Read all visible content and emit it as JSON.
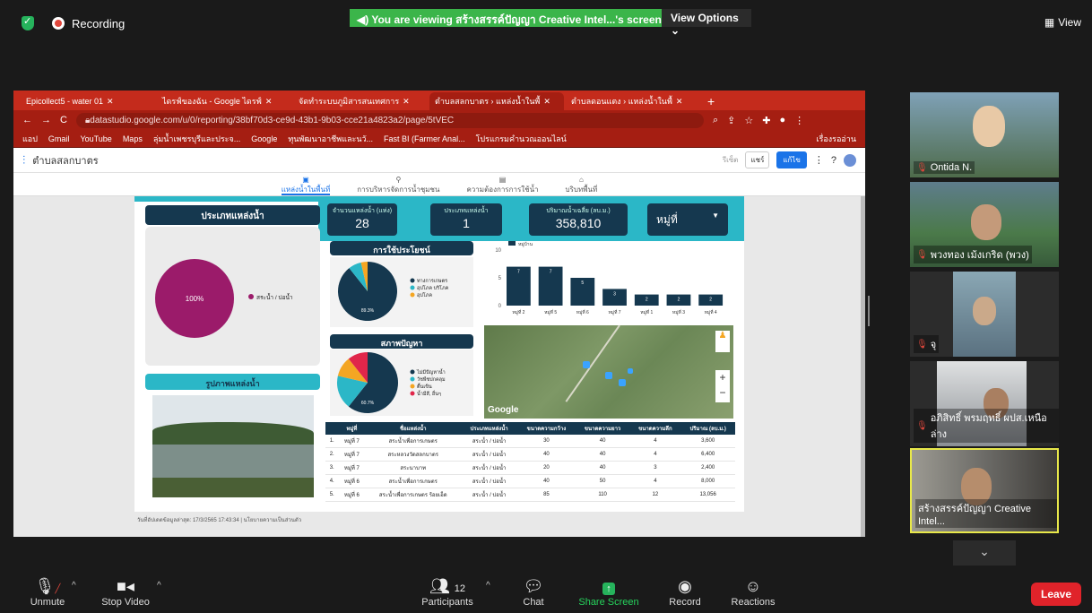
{
  "zoom": {
    "recording_label": "Recording",
    "banner": "You are viewing สร้างสรรค์ปัญญา Creative Intel...'s screen",
    "view_options": "View Options",
    "view_button": "View",
    "toolbar": {
      "unmute": "Unmute",
      "stop_video": "Stop Video",
      "participants": "Participants",
      "participants_count": "12",
      "chat": "Chat",
      "share_screen": "Share Screen",
      "record": "Record",
      "reactions": "Reactions",
      "leave": "Leave"
    },
    "participants": [
      {
        "name": "Ontida N.",
        "muted": true
      },
      {
        "name": "พวงทอง เม้งเกริด (พวง)",
        "muted": true
      },
      {
        "name": "จุ",
        "muted": true
      },
      {
        "name": "อภิสิทธิ์ พรมฤทธิ์ ผปส.เหนือล่าง",
        "muted": true
      },
      {
        "name": "สร้างสรรค์ปัญญา Creative Intel...",
        "muted": false
      }
    ]
  },
  "browser": {
    "tabs": [
      {
        "label": "Epicollect5 - water 01",
        "active": false
      },
      {
        "label": "ไดรฟ์ของฉัน - Google ไดรฟ์",
        "active": false
      },
      {
        "label": "จัดทำระบบภูมิสารสนเทศการ",
        "active": false
      },
      {
        "label": "ตำบลสลกบาตร › แหล่งน้ำในพื้",
        "active": true
      },
      {
        "label": "ตำบลดอนแตง › แหล่งน้ำในพื้",
        "active": false
      }
    ],
    "url": "datastudio.google.com/u/0/reporting/38bf70d3-ce9d-43b1-9b03-cce21a4823a2/page/5tVEC",
    "bookmarks": [
      "แอป",
      "Gmail",
      "YouTube",
      "Maps",
      "ลุ่มน้ำเพชรบุรีและประจ...",
      "Google",
      "ทุนพัฒนาอาชีพและนวั...",
      "Fast BI (Farmer Anal...",
      "โปรแกรมคำนวณออนไลน์"
    ],
    "reading_list": "เรื่องรออ่าน"
  },
  "report": {
    "title": "ตำบลสลกบาตร",
    "nav": [
      "แหล่งน้ำในพื้นที่",
      "การบริหารจัดการน้ำชุมชน",
      "ความต้องการการใช้น้ำ",
      "บริบทพื้นที่"
    ],
    "reset": "รีเซ็ต",
    "share": "แชร์",
    "edit": "แก้ไข",
    "water_type_header": "ประเภทแหล่งน้ำ",
    "water_type_pie": {
      "label": "สระน้ำ / บ่อน้ำ",
      "percent": "100%",
      "color": "#9b1b6a"
    },
    "kpis": [
      {
        "label": "จำนวนแหล่งน้ำ (แห่ง)",
        "value": "28"
      },
      {
        "label": "ประเภทแหล่งน้ำ",
        "value": "1"
      },
      {
        "label": "ปริมาณน้ำเฉลี่ย (ลบ.ม.)",
        "value": "358,810"
      }
    ],
    "village_select": "หมู่ที่",
    "usage_header": "การใช้ประโยชน์",
    "usage_legend": [
      "ทางการเกษตร",
      "อุปโภค บริโภค",
      "อุปโภค"
    ],
    "usage_percent": "89.3%",
    "problem_header": "สภาพปัญหา",
    "problem_legend": [
      "ไม่มีปัญหาน้ำ",
      "วัชพืชปกคลุม",
      "ตื้นเขิน",
      "น้ำมีสี, อื่นๆ"
    ],
    "problem_percent": "60.7%",
    "photo_header": "รูปภาพแหล่งน้ำ",
    "map_label": "Google",
    "footer": "วันที่อัปเดตข้อมูลล่าสุด: 17/3/2565 17:43:34 | นโยบายความเป็นส่วนตัว",
    "table_headers": [
      "",
      "หมู่ที่",
      "ชื่อแหล่งน้ำ",
      "ประเภทแหล่งน้ำ",
      "ขนาดความกว้าง",
      "ขนาดความยาว",
      "ขนาดความลึก",
      "ปริมาณ (ลบ.ม.)"
    ],
    "table_rows": [
      [
        "1.",
        "หมู่ที่ 7",
        "สระน้ำเพื่อการเกษตร",
        "สระน้ำ / บ่อน้ำ",
        "30",
        "40",
        "4",
        "3,600"
      ],
      [
        "2.",
        "หมู่ที่ 7",
        "สระหลวงวัดสลกบาตร",
        "สระน้ำ / บ่อน้ำ",
        "40",
        "40",
        "4",
        "6,400"
      ],
      [
        "3.",
        "หมู่ที่ 7",
        "สระนาบาท",
        "สระน้ำ / บ่อน้ำ",
        "20",
        "40",
        "3",
        "2,400"
      ],
      [
        "4.",
        "หมู่ที่ 6",
        "สระน้ำเพื่อการเกษตร",
        "สระน้ำ / บ่อน้ำ",
        "40",
        "50",
        "4",
        "8,000"
      ],
      [
        "5.",
        "หมู่ที่ 6",
        "สระน้ำเพื่อการเกษตร ร้อยเอ็ด",
        "สระน้ำ / บ่อน้ำ",
        "85",
        "110",
        "12",
        "13,056"
      ]
    ]
  },
  "chart_data": [
    {
      "type": "bar",
      "title": "",
      "series": [
        {
          "name": "หมู่บ้าน",
          "values": [
            7,
            7,
            5,
            3,
            2,
            2,
            2
          ]
        }
      ],
      "categories": [
        "หมู่ที่ 2",
        "หมู่ที่ 5",
        "หมู่ที่ 6",
        "หมู่ที่ 7",
        "หมู่ที่ 1",
        "หมู่ที่ 3",
        "หมู่ที่ 4"
      ],
      "ylim": [
        0,
        10
      ],
      "yticks": [
        0,
        5,
        10
      ],
      "color": "#15384f"
    },
    {
      "type": "pie",
      "title": "การใช้ประโยชน์",
      "slices": [
        {
          "label": "ทางการเกษตร",
          "value": 89.3,
          "color": "#15384f"
        },
        {
          "label": "อุปโภค บริโภค",
          "value": 7.1,
          "color": "#2bb7c7"
        },
        {
          "label": "อุปโภค",
          "value": 3.6,
          "color": "#f4a623"
        }
      ]
    },
    {
      "type": "pie",
      "title": "สภาพปัญหา",
      "slices": [
        {
          "label": "ไม่มีปัญหาน้ำ",
          "value": 60.7,
          "color": "#15384f"
        },
        {
          "label": "วัชพืชปกคลุม",
          "value": 17.9,
          "color": "#2bb7c7"
        },
        {
          "label": "ตื้นเขิน",
          "value": 10.7,
          "color": "#f4a623"
        },
        {
          "label": "น้ำมีสี, อื่นๆ",
          "value": 10.7,
          "color": "#e0264a"
        }
      ]
    },
    {
      "type": "pie",
      "title": "ประเภทแหล่งน้ำ",
      "slices": [
        {
          "label": "สระน้ำ / บ่อน้ำ",
          "value": 100,
          "color": "#9b1b6a"
        }
      ]
    }
  ]
}
